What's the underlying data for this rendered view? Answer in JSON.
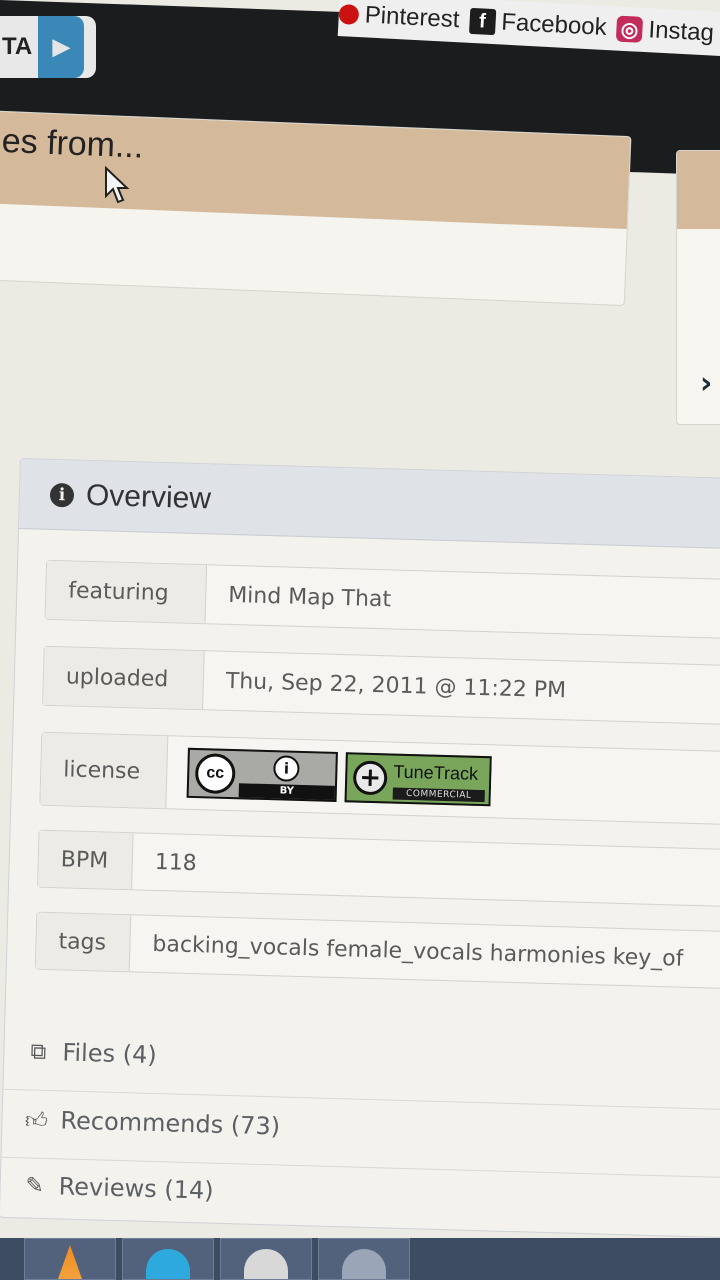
{
  "header": {
    "social_links": [
      {
        "label": "Pinterest",
        "icon": "pinterest-icon"
      },
      {
        "label": "Facebook",
        "icon": "facebook-icon"
      },
      {
        "label": "Instag",
        "icon": "instagram-icon"
      }
    ],
    "tab_label": "TA",
    "play_icon": "▶"
  },
  "top_card": {
    "text": "es from..."
  },
  "overview": {
    "title": "Overview",
    "rows": {
      "featuring": {
        "key": "featuring",
        "value": "Mind Map That"
      },
      "uploaded": {
        "key": "uploaded",
        "value": "Thu, Sep 22, 2011 @ 11:22 PM"
      },
      "license": {
        "key": "license",
        "cc_badge": {
          "cc": "cc",
          "by": "BY",
          "icon": "creative-commons-icon"
        },
        "tunetrack_badge": {
          "name": "TuneTrack",
          "sub": "COMMERCIAL",
          "icon": "plus-icon"
        }
      },
      "bpm": {
        "key": "BPM",
        "value": "118"
      },
      "tags": {
        "key": "tags",
        "value": "backing_vocals female_vocals harmonies key_of"
      }
    },
    "sections": {
      "files": "Files (4)",
      "recommends": "Recommends (73)",
      "reviews": "Reviews (14)"
    }
  },
  "colors": {
    "header_bg": "#1b1c1e",
    "accent_band": "#d5b99b",
    "play_blue": "#3a88b7",
    "panel_head": "#dfe3e8",
    "taskbar": "#3d4b63"
  }
}
